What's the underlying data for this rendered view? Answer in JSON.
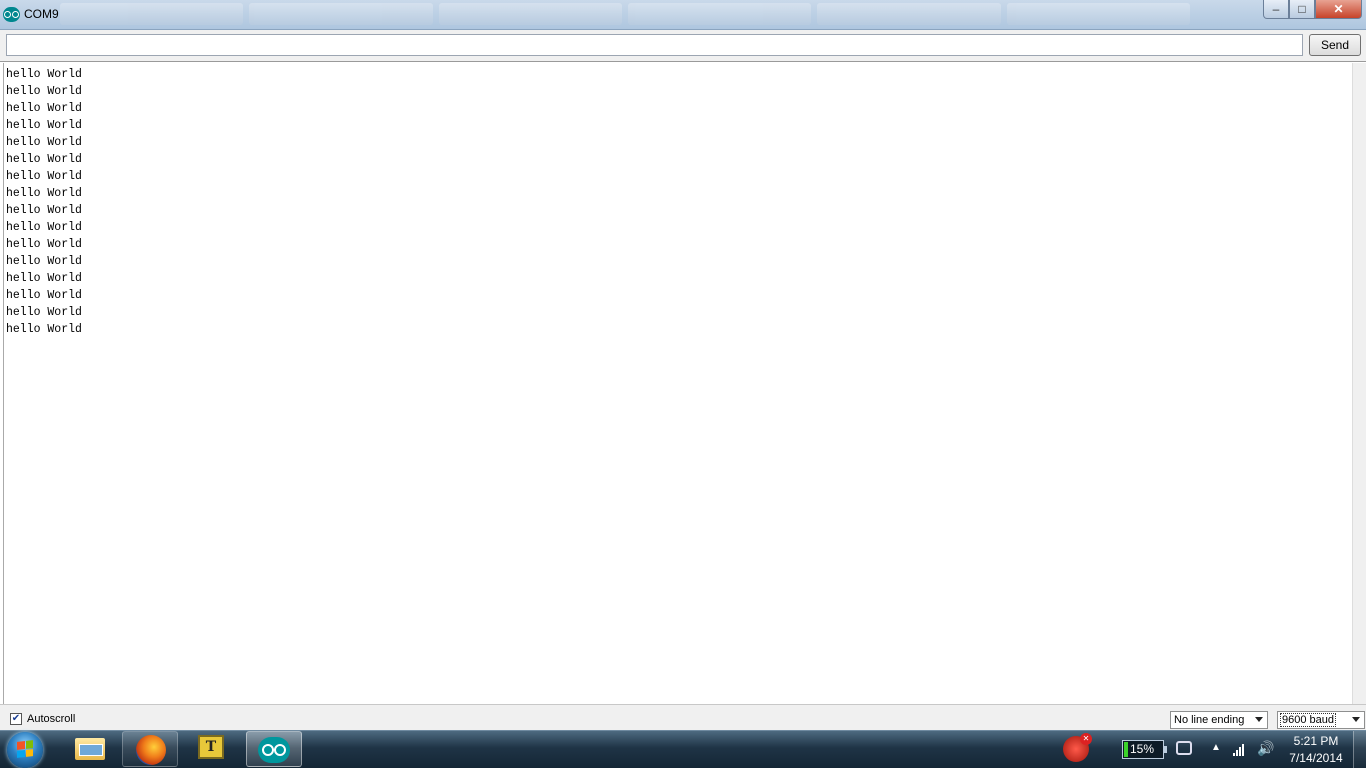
{
  "window": {
    "title": "COM9"
  },
  "send_row": {
    "input_value": "",
    "send_label": "Send"
  },
  "output": {
    "lines": [
      "hello World",
      "hello World",
      "hello World",
      "hello World",
      "hello World",
      "hello World",
      "hello World",
      "hello World",
      "hello World",
      "hello World",
      "hello World",
      "hello World",
      "hello World",
      "hello World",
      "hello World",
      "hello World"
    ]
  },
  "bottom_bar": {
    "autoscroll_checked": true,
    "autoscroll_label": "Autoscroll",
    "line_ending_value": "No line ending",
    "baud_value": "9600 baud"
  },
  "taskbar": {
    "battery_percent": "15%",
    "clock_time": "5:21 PM",
    "clock_date": "7/14/2014"
  },
  "icons": {
    "app": "arduino-icon",
    "start": "windows-start-icon",
    "explorer": "folder-icon",
    "firefox": "firefox-icon",
    "tray": [
      "battery-icon",
      "plug-icon",
      "signal-icon",
      "volume-icon"
    ]
  }
}
